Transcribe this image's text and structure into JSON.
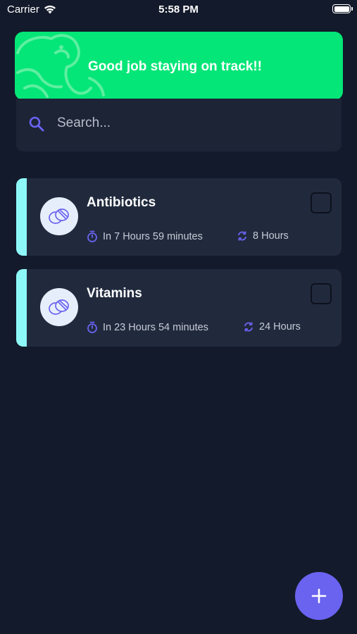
{
  "status_bar": {
    "carrier": "Carrier",
    "time": "5:58 PM",
    "icons": [
      "wifi-icon",
      "battery-icon"
    ]
  },
  "banner": {
    "message": "Good job staying on track!!",
    "color": "#04e677"
  },
  "search": {
    "placeholder": "Search...",
    "value": ""
  },
  "medications": [
    {
      "name": "Antibiotics",
      "next_dose": "In 7 Hours 59 minutes",
      "interval": "8 Hours",
      "checked": false
    },
    {
      "name": "Vitamins",
      "next_dose": "In 23 Hours 54 minutes",
      "interval": "24 Hours",
      "checked": false
    }
  ],
  "fab": {
    "icon": "plus-icon",
    "color": "#6a63f0"
  },
  "theme": {
    "background": "#131a2b",
    "card": "#212a3d",
    "accent_stripe": "#8ef8f8",
    "icon_accent": "#6a63f0"
  }
}
